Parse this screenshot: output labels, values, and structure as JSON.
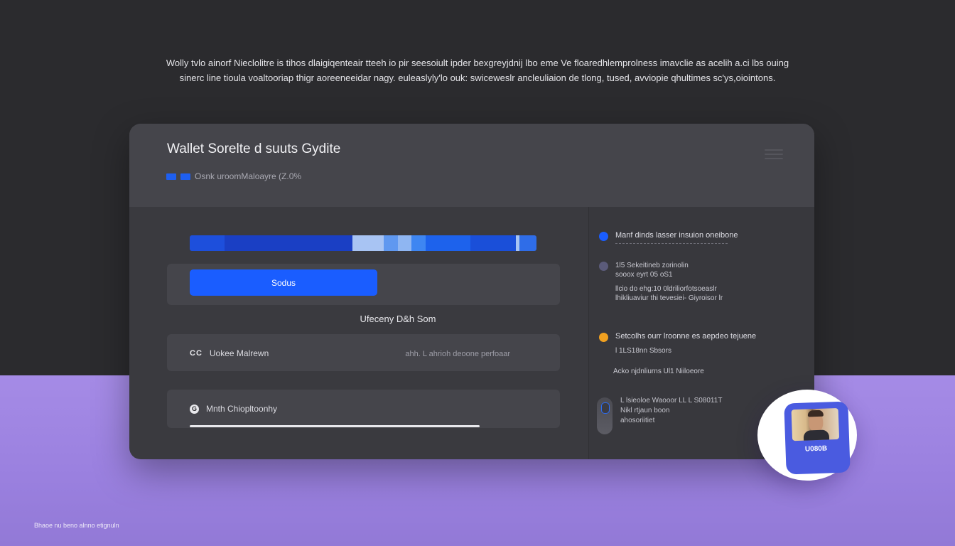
{
  "intro": {
    "line1": "Wolly tvlo ainorf Nieclolitre is tihos dlaigiqenteair tteeh io pir seesoiult ipder bexgreyjdnij lbo eme Ve floaredhlemprolness imavclie as acelih a.ci lbs ouing",
    "line2": "sinerc line tioula voaltooriap  thigr aoreeneeidar nagy. euleaslyly'lo ouk: swiceweslr ancleuliaion de tlong, tused, avviopie qhultimes sc'ys,oiointons."
  },
  "card": {
    "title": "Wallet Sorelte d suuts Gydite",
    "subtitle": "Osnk uroomMaloayre (Z.0%",
    "progress_segments": [
      {
        "fraction": 0.1,
        "color": "#1d4fdc"
      },
      {
        "fraction": 0.37,
        "color": "#1a3fc4"
      },
      {
        "fraction": 0.09,
        "color": "#a8c4f3"
      },
      {
        "fraction": 0.04,
        "color": "#5f98f0"
      },
      {
        "fraction": 0.04,
        "color": "#8fb6f2"
      },
      {
        "fraction": 0.04,
        "color": "#3e86f2"
      },
      {
        "fraction": 0.13,
        "color": "#1d62ec"
      },
      {
        "fraction": 0.13,
        "color": "#1a4fd9"
      },
      {
        "fraction": 0.01,
        "color": "#a8c4f3"
      },
      {
        "fraction": 0.05,
        "color": "#2f6de8"
      }
    ],
    "primary_button": "Sodus",
    "center_label": "Ufeceny D&h Som",
    "row1": {
      "left_label": "Uokee Malrewn",
      "right_label": "ahh. L ahrioh deoone perfoaar"
    },
    "row2": {
      "label": "Mnth Chiopltoonhy",
      "underline_fraction": 0.74
    }
  },
  "steps": [
    {
      "color": "#1a5dff",
      "lines": [
        "Manf dinds lasser insuion oneibone"
      ]
    },
    {
      "color": "#5b5b7a",
      "lines": [
        "1l5 Sekeitineb zorinolin",
        "sooox eyrt 05 oS1",
        "llcio do ehg:10 0ldriliorfotsoeaslr",
        "lhikliuaviur thi tevesiei- Giyroisor lr"
      ]
    },
    {
      "color": "#f0a020",
      "lines": [
        "Setcolhs ourr lroonne es aepdeo tejuene",
        "l 1LS18nn Sbsors"
      ]
    }
  ],
  "aside_label": "Acko njdnliurns Ul1 Niiloeore",
  "bottom_note": {
    "lines": [
      "L lsieoloe  Waooor LL L S08011T",
      "Nikl rtjaun boon",
      "ahosoriitiet"
    ]
  },
  "avatar": {
    "label": "U080B"
  },
  "footer": "Bhaoe nu beno alnno etignuln"
}
